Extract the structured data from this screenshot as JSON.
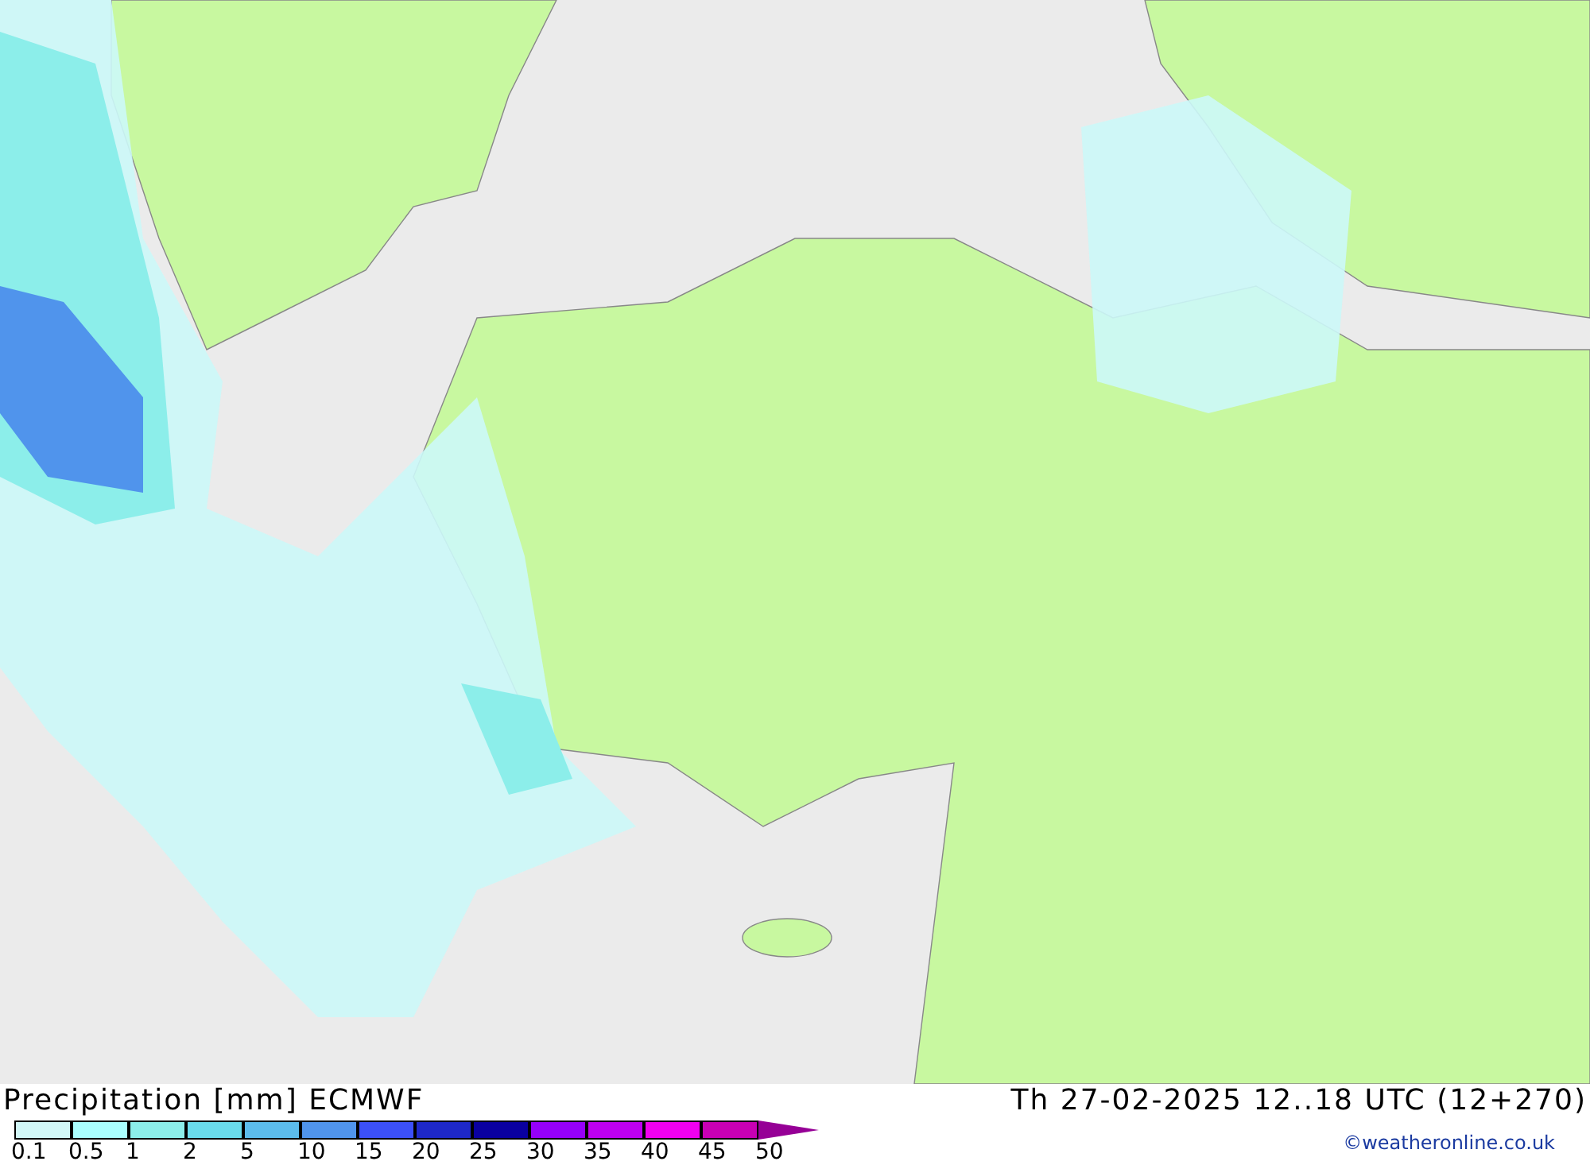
{
  "title": "Precipitation [mm] ECMWF",
  "valid_time": "Th 27-02-2025 12..18 UTC (12+270)",
  "legend": {
    "swatches": [
      {
        "kind": "band",
        "color": "#d2f8f8"
      },
      {
        "kind": "band",
        "color": "#aaffff"
      },
      {
        "kind": "band",
        "color": "#8ceeea"
      },
      {
        "kind": "band",
        "color": "#6adcec"
      },
      {
        "kind": "band",
        "color": "#5cbcec"
      },
      {
        "kind": "band",
        "color": "#5094ec"
      },
      {
        "kind": "band",
        "color": "#3c50f8"
      },
      {
        "kind": "band",
        "color": "#1e28c8"
      },
      {
        "kind": "band",
        "color": "#0a00a0"
      },
      {
        "kind": "band",
        "color": "#9600fa"
      },
      {
        "kind": "band",
        "color": "#be00f0"
      },
      {
        "kind": "band",
        "color": "#f000f0"
      },
      {
        "kind": "band",
        "color": "#c800b4"
      },
      {
        "kind": "arrow",
        "color": "#960096"
      }
    ],
    "labels": [
      "0.1",
      "0.5",
      "1",
      "2",
      "5",
      "10",
      "15",
      "20",
      "25",
      "30",
      "35",
      "40",
      "45",
      "50"
    ]
  },
  "credit": "©weatheronline.co.uk"
}
